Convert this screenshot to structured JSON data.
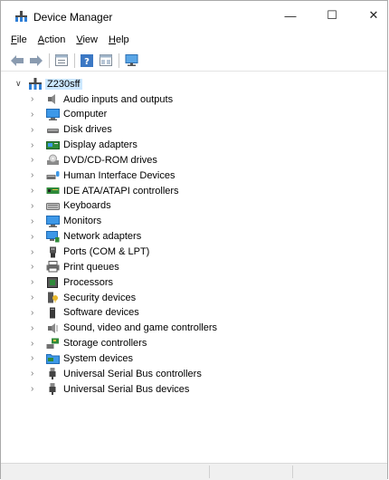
{
  "window": {
    "title": "Device Manager",
    "controls": {
      "minimize": "—",
      "maximize": "☐",
      "close": "✕"
    }
  },
  "menu": [
    {
      "accel": "F",
      "rest": "ile"
    },
    {
      "accel": "A",
      "rest": "ction"
    },
    {
      "accel": "V",
      "rest": "iew"
    },
    {
      "accel": "H",
      "rest": "elp"
    }
  ],
  "tree": {
    "root": {
      "label": "Z230sff",
      "icon": "computer-network-icon"
    },
    "items": [
      {
        "label": "Audio inputs and outputs",
        "icon": "speaker-icon"
      },
      {
        "label": "Computer",
        "icon": "monitor-icon"
      },
      {
        "label": "Disk drives",
        "icon": "disk-drive-icon"
      },
      {
        "label": "Display adapters",
        "icon": "display-adapter-icon"
      },
      {
        "label": "DVD/CD-ROM drives",
        "icon": "dvd-drive-icon"
      },
      {
        "label": "Human Interface Devices",
        "icon": "hid-icon"
      },
      {
        "label": "IDE ATA/ATAPI controllers",
        "icon": "ide-controller-icon"
      },
      {
        "label": "Keyboards",
        "icon": "keyboard-icon"
      },
      {
        "label": "Monitors",
        "icon": "monitor-icon"
      },
      {
        "label": "Network adapters",
        "icon": "network-adapter-icon"
      },
      {
        "label": "Ports (COM & LPT)",
        "icon": "port-icon"
      },
      {
        "label": "Print queues",
        "icon": "printer-icon"
      },
      {
        "label": "Processors",
        "icon": "processor-icon"
      },
      {
        "label": "Security devices",
        "icon": "security-device-icon"
      },
      {
        "label": "Software devices",
        "icon": "software-device-icon"
      },
      {
        "label": "Sound, video and game controllers",
        "icon": "sound-icon"
      },
      {
        "label": "Storage controllers",
        "icon": "storage-controller-icon"
      },
      {
        "label": "System devices",
        "icon": "system-folder-icon"
      },
      {
        "label": "Universal Serial Bus controllers",
        "icon": "usb-icon"
      },
      {
        "label": "Universal Serial Bus devices",
        "icon": "usb-icon"
      }
    ]
  },
  "colors": {
    "selection": "#cce8ff",
    "monitor_blue": "#1e7fd6",
    "toolbar_blue": "#3b78c4"
  }
}
